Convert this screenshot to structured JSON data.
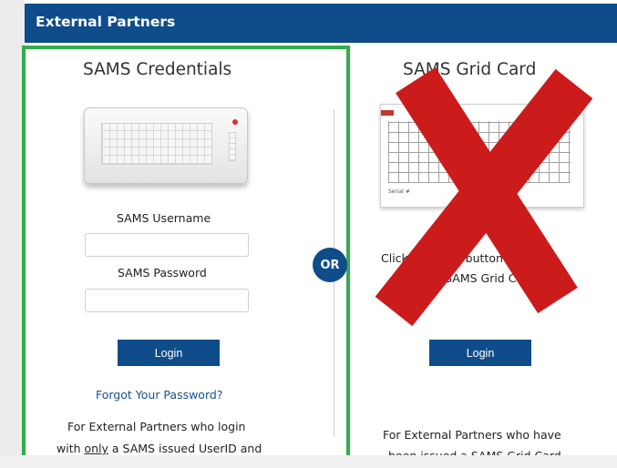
{
  "header": {
    "title": "External Partners"
  },
  "credentials": {
    "title": "SAMS Credentials",
    "username_label": "SAMS Username",
    "username_value": "",
    "password_label": "SAMS Password",
    "password_value": "",
    "login_label": "Login",
    "forgot_label": "Forgot Your Password?",
    "desc_line1": "For External Partners who login",
    "desc_line2_pre": "with ",
    "desc_line2_underlined": "only",
    "desc_line2_post": " a SAMS issued UserID and"
  },
  "or_label": "OR",
  "gridcard": {
    "title": "SAMS Grid Card",
    "instruction_line1": "Click the login button to",
    "instruction_line2": "use SAMS Grid Card",
    "login_label": "Login",
    "desc_line1": "For External Partners who have",
    "desc_line2": "been issued a SAMS Grid Card.",
    "card_serial": "Serial #"
  },
  "colors": {
    "brand": "#0f4c8a",
    "highlight": "#2fae49",
    "cross": "#cc1b1b"
  },
  "icons": {
    "keyboard": "keyboard-icon",
    "grid_card": "grid-card-icon",
    "cross": "red-x-icon"
  }
}
